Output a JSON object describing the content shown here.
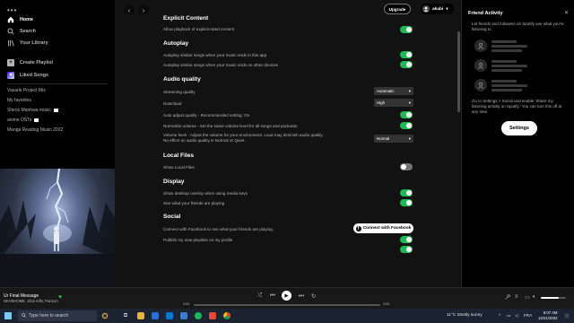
{
  "sidebar": {
    "dots": "•••",
    "nav": [
      {
        "label": "Home",
        "icon": "home-icon"
      },
      {
        "label": "Search",
        "icon": "search-icon"
      },
      {
        "label": "Your Library",
        "icon": "library-icon"
      }
    ],
    "actions": [
      {
        "label": "Create Playlist",
        "icon": "plus-icon"
      },
      {
        "label": "Liked Songs",
        "icon": "heart-icon"
      }
    ],
    "playlists": [
      "Vasarle Project Mix",
      "My favorites",
      "Shiros Manhwa music",
      "anime OSTs",
      "Manga Reading Music 2022"
    ]
  },
  "topbar": {
    "upgrade": "Upgrade",
    "user": "akabi",
    "back": "‹",
    "forward": "›"
  },
  "settings": {
    "explicit": {
      "title": "Explicit Content",
      "rows": [
        {
          "label": "Allow playback of explicit-rated content",
          "on": true
        }
      ]
    },
    "autoplay": {
      "title": "Autoplay",
      "rows": [
        {
          "label": "Autoplay similar songs when your music ends in this app",
          "on": true
        },
        {
          "label": "Autoplay similar songs when your music ends on other devices",
          "on": true
        }
      ]
    },
    "audio": {
      "title": "Audio quality",
      "streaming_label": "Streaming quality",
      "streaming_value": "Automatic",
      "download_label": "Download",
      "download_value": "High",
      "auto_adjust_label": "Auto adjust quality - Recommended setting: On",
      "normalize_label": "Normalize volume - Set the same volume level for all songs and podcasts",
      "volume_level_label": "Volume level - Adjust the volume for your environment. Loud may diminish audio quality. No effect on audio quality in Normal or Quiet.",
      "volume_level_value": "Normal"
    },
    "local": {
      "title": "Local Files",
      "show_label": "Show Local Files"
    },
    "display": {
      "title": "Display",
      "rows": [
        {
          "label": "Show desktop overlay when using media keys",
          "on": true
        },
        {
          "label": "See what your friends are playing",
          "on": true
        }
      ]
    },
    "social": {
      "title": "Social",
      "connect_label": "Connect with Facebook to see what your friends are playing.",
      "connect_button": "Connect with Facebook",
      "publish_label": "Publish my new playlists on my profile"
    }
  },
  "friends": {
    "title": "Friend Activity",
    "intro": "Let friends and followers on Spotify see what you're listening to.",
    "info": "Go to Settings > Social and enable 'Share my listening activity on Spotify.' You can turn this off at any time.",
    "settings_button": "Settings"
  },
  "player": {
    "title": "Ur Final Message",
    "artist": "DEVBHOME, Slick Kills, Pannon",
    "elapsed": "0:00",
    "duration": "3:00",
    "progress": 0.0
  },
  "taskbar": {
    "search_placeholder": "Type here to search",
    "weather": "11°C  Mostly sunny",
    "lang": "FRA",
    "time": "9:07 AM",
    "date": "12/21/2022"
  },
  "colors": {
    "accent": "#1db954",
    "background": "#121212",
    "sidebar": "#000000"
  }
}
